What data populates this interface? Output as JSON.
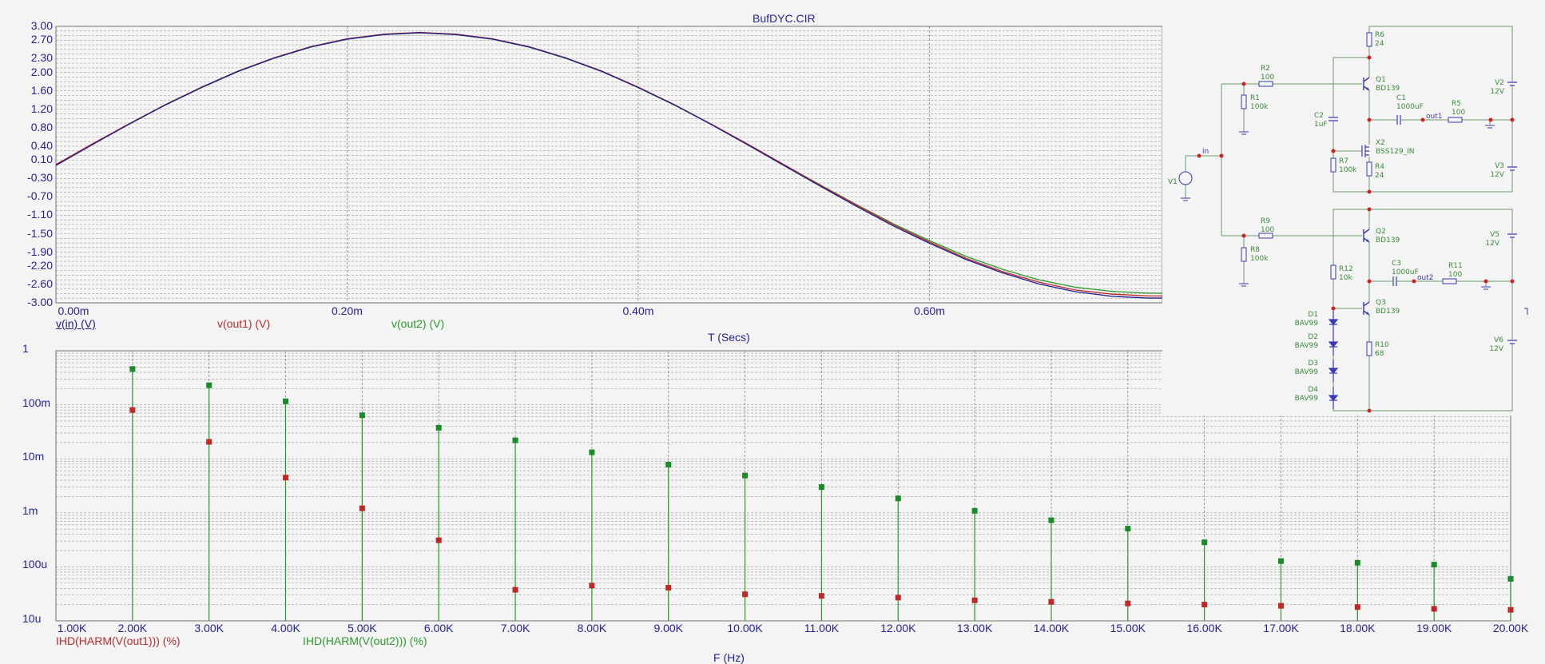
{
  "window": {
    "title": "BufDYC.CIR"
  },
  "colors": {
    "v_in": "#1c1c8c",
    "v_out1": "#c02828",
    "v_out2": "#2a9a2a",
    "axis_text": "#23239a",
    "wire": "#6a9a6a",
    "component": "#3a3ab4",
    "node": "#d02020"
  },
  "chart_data": [
    {
      "type": "line",
      "title": "BufDYC.CIR",
      "xlabel": "T (Secs)",
      "ylabel": "",
      "xlim": [
        0,
        0.76
      ],
      "ylim": [
        -3,
        3
      ],
      "x_unit": "ms",
      "x_ticks": [
        0,
        0.2,
        0.4,
        0.6
      ],
      "x_tick_labels": [
        "0.00m",
        "0.20m",
        "0.40m",
        "0.60m"
      ],
      "y_tick_values": [
        3.0,
        2.7,
        2.3,
        2.0,
        1.6,
        1.2,
        0.8,
        0.4,
        0.1,
        -0.3,
        -0.7,
        -1.1,
        -1.5,
        -1.9,
        -2.2,
        -2.6,
        -3.0
      ],
      "y_tick_labels": [
        "3.00",
        "2.70",
        "2.30",
        "2.00",
        "1.60",
        "1.20",
        "0.80",
        "0.40",
        "0.10",
        "-0.30",
        "-0.70",
        "-1.10",
        "-1.50",
        "-1.90",
        "-2.20",
        "-2.60",
        "-3.00"
      ],
      "grid": true,
      "x": [
        0,
        0.025,
        0.05,
        0.075,
        0.1,
        0.125,
        0.15,
        0.175,
        0.2,
        0.225,
        0.25,
        0.275,
        0.3,
        0.325,
        0.35,
        0.375,
        0.4,
        0.425,
        0.45,
        0.475,
        0.5,
        0.525,
        0.55,
        0.575,
        0.6,
        0.625,
        0.65,
        0.675,
        0.7,
        0.725,
        0.75,
        0.76
      ],
      "series": [
        {
          "name": "v(in) (V)",
          "values": [
            0,
            0.45,
            0.89,
            1.31,
            1.69,
            2.04,
            2.33,
            2.57,
            2.74,
            2.84,
            2.88,
            2.84,
            2.74,
            2.57,
            2.33,
            2.04,
            1.69,
            1.31,
            0.89,
            0.45,
            0,
            -0.45,
            -0.89,
            -1.31,
            -1.69,
            -2.04,
            -2.33,
            -2.57,
            -2.74,
            -2.84,
            -2.88,
            -2.88
          ]
        },
        {
          "name": "v(out1) (V)",
          "values": [
            0,
            0.45,
            0.88,
            1.3,
            1.68,
            2.03,
            2.32,
            2.56,
            2.73,
            2.83,
            2.87,
            2.83,
            2.73,
            2.56,
            2.32,
            2.03,
            1.68,
            1.3,
            0.88,
            0.45,
            0,
            -0.45,
            -0.88,
            -1.3,
            -1.68,
            -2.03,
            -2.32,
            -2.55,
            -2.72,
            -2.81,
            -2.85,
            -2.85
          ]
        },
        {
          "name": "v(out2) (V)",
          "values": [
            0,
            0.44,
            0.88,
            1.29,
            1.67,
            2.02,
            2.31,
            2.55,
            2.72,
            2.82,
            2.86,
            2.82,
            2.72,
            2.55,
            2.31,
            2.02,
            1.67,
            1.29,
            0.88,
            0.44,
            0,
            -0.44,
            -0.87,
            -1.28,
            -1.65,
            -1.99,
            -2.27,
            -2.5,
            -2.66,
            -2.75,
            -2.79,
            -2.79
          ]
        }
      ],
      "legend": [
        "v(in) (V)",
        "v(out1) (V)",
        "v(out2) (V)"
      ],
      "legend_placement": "bottom"
    },
    {
      "type": "scatter",
      "title": "",
      "xlabel": "F (Hz)",
      "ylabel": "",
      "xlim": [
        1000,
        20000
      ],
      "ylim": [
        1e-05,
        1
      ],
      "yscale": "log",
      "x_tick_labels": [
        "1.00K",
        "2.00K",
        "3.00K",
        "4.00K",
        "5.00K",
        "6.00K",
        "7.00K",
        "8.00K",
        "9.00K",
        "10.00K",
        "11.00K",
        "12.00K",
        "13.00K",
        "14.00K",
        "15.00K",
        "16.00K",
        "17.00K",
        "18.00K",
        "19.00K",
        "20.00K"
      ],
      "y_tick_values": [
        1,
        0.1,
        0.01,
        0.001,
        0.0001,
        1e-05
      ],
      "y_tick_labels": [
        "1",
        "100m",
        "10m",
        "1m",
        "100u",
        "10u"
      ],
      "grid": true,
      "x": [
        2000,
        3000,
        4000,
        5000,
        6000,
        7000,
        8000,
        9000,
        10000,
        11000,
        12000,
        13000,
        14000,
        15000,
        16000,
        17000,
        18000,
        19000,
        20000
      ],
      "series": [
        {
          "name": "IHD(HARM(V(out1))) (%)",
          "values": [
            0.08,
            0.0206,
            0.0045,
            0.00121,
            0.00031,
            3.76e-05,
            4.5e-05,
            4.1e-05,
            3.1e-05,
            2.9e-05,
            2.7e-05,
            2.4e-05,
            2.25e-05,
            2.1e-05,
            2e-05,
            1.9e-05,
            1.8e-05,
            1.67e-05,
            1.6e-05
          ]
        },
        {
          "name": "IHD(HARM(V(out2))) (%)",
          "values": [
            0.46,
            0.23,
            0.116,
            0.064,
            0.0376,
            0.022,
            0.0132,
            0.0078,
            0.0049,
            0.003,
            0.00185,
            0.00109,
            0.00073,
            0.00051,
            0.000284,
            0.000128,
            0.000119,
            0.00011,
            6e-05
          ]
        }
      ],
      "legend": [
        "IHD(HARM(V(out1))) (%)",
        "IHD(HARM(V(out2))) (%)"
      ],
      "legend_placement": "bottom"
    }
  ],
  "schematic": {
    "components": [
      {
        "ref": "R6",
        "value": "24"
      },
      {
        "ref": "R2",
        "value": "100"
      },
      {
        "ref": "R1",
        "value": "100k"
      },
      {
        "ref": "Q1",
        "value": "BD139"
      },
      {
        "ref": "C1",
        "value": "1000uF"
      },
      {
        "ref": "R5",
        "value": "100"
      },
      {
        "ref": "V2",
        "value": "12V"
      },
      {
        "ref": "C2",
        "value": "1uF"
      },
      {
        "ref": "X2",
        "value": "BSS129_IN"
      },
      {
        "ref": "R7",
        "value": "100k"
      },
      {
        "ref": "R4",
        "value": "24"
      },
      {
        "ref": "V3",
        "value": "12V"
      },
      {
        "ref": "V1",
        "value": ""
      },
      {
        "ref": "R9",
        "value": "100"
      },
      {
        "ref": "R8",
        "value": "100k"
      },
      {
        "ref": "Q2",
        "value": "BD139"
      },
      {
        "ref": "C3",
        "value": "1000uF"
      },
      {
        "ref": "R11",
        "value": "100"
      },
      {
        "ref": "V5",
        "value": "12V"
      },
      {
        "ref": "R12",
        "value": "10k"
      },
      {
        "ref": "Q3",
        "value": "BD139"
      },
      {
        "ref": "R10",
        "value": "68"
      },
      {
        "ref": "V6",
        "value": "12V"
      },
      {
        "ref": "D1",
        "value": "BAV99"
      },
      {
        "ref": "D2",
        "value": "BAV99"
      },
      {
        "ref": "D3",
        "value": "BAV99"
      },
      {
        "ref": "D4",
        "value": "BAV99"
      }
    ],
    "nets": {
      "input": "in",
      "out1": "out1",
      "out2": "out2"
    }
  }
}
